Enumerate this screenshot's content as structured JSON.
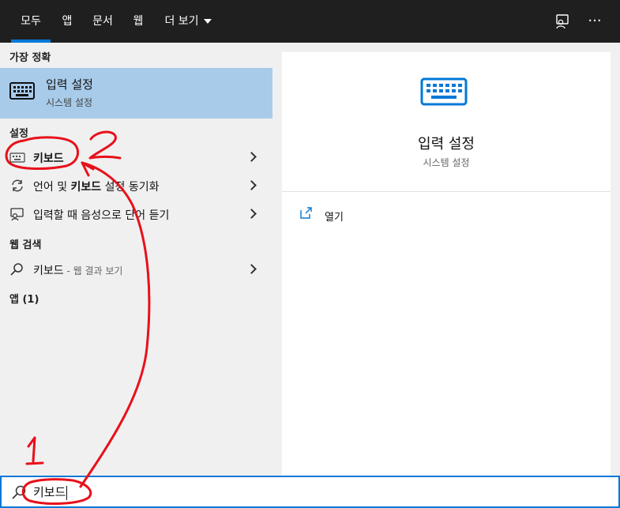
{
  "tabs": [
    {
      "label": "모두",
      "active": true
    },
    {
      "label": "앱"
    },
    {
      "label": "문서"
    },
    {
      "label": "웹"
    },
    {
      "label": "더 보기"
    }
  ],
  "top_icons": [
    "feedback-icon",
    "more-options-icon"
  ],
  "more_icon_glyph": "···",
  "left": {
    "best_match_header": "가장 정확",
    "best_match": {
      "title": "입력 설정",
      "subtitle": "시스템 설정",
      "icon": "keyboard-icon"
    },
    "settings_header": "설정",
    "settings": [
      {
        "pre": "",
        "bold": "키보드",
        "post": "",
        "icon": "keyboard-small-icon"
      },
      {
        "pre": "언어 및 ",
        "bold": "키보드",
        "post": " 설정 동기화",
        "icon": "sync-icon"
      },
      {
        "pre": "입력할 때 음성으로 단어 듣기",
        "bold": "",
        "post": "",
        "icon": "narrator-icon"
      }
    ],
    "web_header": "웹 검색",
    "web_item": {
      "label": "키보드",
      "sub": " - 웹 결과 보기",
      "icon": "search-icon"
    },
    "apps_header": "앱 (1)"
  },
  "preview": {
    "title": "입력 설정",
    "subtitle": "시스템 설정",
    "open_label": "열기",
    "accent": "#0078d7"
  },
  "search": {
    "value": "키보드"
  },
  "annotations": {
    "label_1": "1",
    "label_2": "2",
    "color": "#e8101a"
  }
}
